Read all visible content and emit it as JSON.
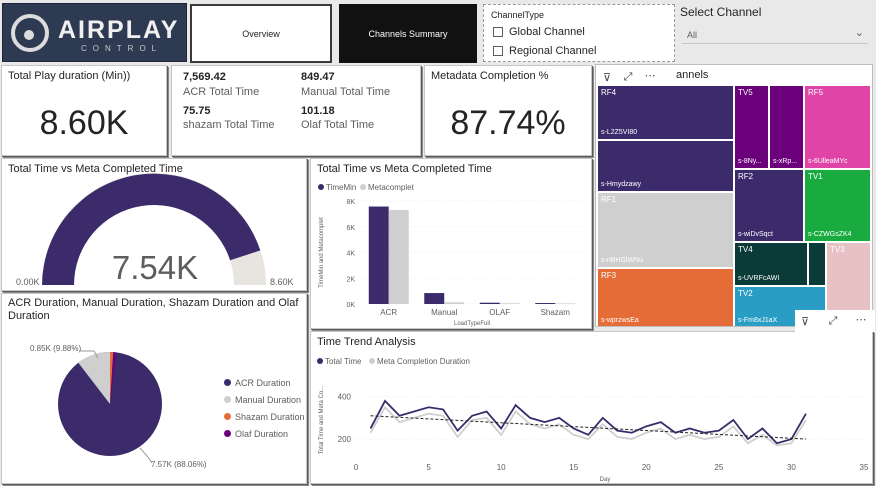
{
  "logo": {
    "main": "AIRPLAY",
    "sub": "CONTROL"
  },
  "nav": {
    "overview": "Overview",
    "channels_summary": "Channels Summary"
  },
  "channel_type": {
    "title": "ChannelType",
    "options": [
      "Global Channel",
      "Regional Channel"
    ]
  },
  "select_channel": {
    "title": "Select Channel",
    "value": "All"
  },
  "total_play": {
    "title": "Total Play duration (Min))",
    "value": "8.60K"
  },
  "multi_card": {
    "acr_value": "7,569.42",
    "acr_label": "ACR Total Time",
    "manual_value": "849.47",
    "manual_label": "Manual Total Time",
    "shazam_value": "75.75",
    "shazam_label": "shazam Total Time",
    "olaf_value": "101.18",
    "olaf_label": "Olaf Total Time"
  },
  "metadata": {
    "title": "Metadata Completion %",
    "value": "87.74%"
  },
  "treemap": {
    "title_suffix": "annels",
    "cells": [
      {
        "head": "RF4",
        "sub": "s-L2Z5VI80"
      },
      {
        "head": "",
        "sub": "s-Hmydzawy"
      },
      {
        "head": "RF1",
        "sub": "s-nBHGlWNu"
      },
      {
        "head": "RF3",
        "sub": "s-wprzwsEa"
      },
      {
        "head": "TV5",
        "sub": "s-8Ny..."
      },
      {
        "head": "",
        "sub": "s-xRp..."
      },
      {
        "head": "RF5",
        "sub": "s-6UlleaMYc"
      },
      {
        "head": "RF2",
        "sub": "s-wiDvSqct"
      },
      {
        "head": "TV1",
        "sub": "s-CZWGsZK4"
      },
      {
        "head": "TV4",
        "sub": "s-UVRFcAWI"
      },
      {
        "head": "",
        "sub": ""
      },
      {
        "head": "TV3",
        "sub": ""
      },
      {
        "head": "TV2",
        "sub": "s-Fm8xJ1aX"
      }
    ]
  },
  "gauge": {
    "title": "Total Time vs Meta Completed Time",
    "value": "7.54K",
    "min": "0.00K",
    "max": "8.60K"
  },
  "pie": {
    "title": "ACR Duration, Manual Duration, Shazam Duration and Olaf Duration",
    "label_small": "0.85K (9.88%)",
    "label_big": "7.57K (88.06%)",
    "legend": [
      "ACR Duration",
      "Manual Duration",
      "Shazam Duration",
      "Olaf Duration"
    ]
  },
  "colors": {
    "purple": "#3b2b6b",
    "grey": "#cfcfcf",
    "orange": "#e66c37",
    "violet": "#6b007b",
    "magenta": "#e044a7",
    "green": "#1aab40",
    "teal": "#2a9dc4",
    "darkgreen": "#0b3b38",
    "pink": "#e8c1c5"
  },
  "chart_data": [
    {
      "type": "bar",
      "title": "Total Time vs Meta Completed Time",
      "categories": [
        "ACR",
        "Manual",
        "OLAF",
        "Shazam"
      ],
      "series": [
        {
          "name": "TimeMin",
          "values": [
            7570,
            850,
            101,
            76
          ]
        },
        {
          "name": "Metacomplet",
          "values": [
            7300,
            130,
            60,
            50
          ]
        }
      ],
      "xlabel": "LoadTypeFull",
      "ylabel": "TimeMin and Metacomplet",
      "yticks": [
        "0K",
        "2K",
        "4K",
        "6K",
        "8K"
      ],
      "ylim": [
        0,
        8000
      ]
    },
    {
      "type": "line",
      "title": "Time Trend Analysis",
      "x": [
        1,
        2,
        3,
        4,
        5,
        6,
        7,
        8,
        9,
        10,
        11,
        12,
        13,
        14,
        15,
        16,
        17,
        18,
        19,
        20,
        21,
        22,
        23,
        24,
        25,
        26,
        27,
        28,
        29,
        30,
        31
      ],
      "series": [
        {
          "name": "Total Time",
          "values": [
            250,
            380,
            310,
            330,
            350,
            340,
            240,
            310,
            330,
            250,
            360,
            300,
            280,
            300,
            250,
            220,
            300,
            240,
            230,
            260,
            280,
            230,
            250,
            230,
            240,
            290,
            200,
            250,
            180,
            200,
            320
          ]
        },
        {
          "name": "Meta Completion Duration",
          "values": [
            230,
            350,
            280,
            300,
            320,
            310,
            210,
            290,
            300,
            220,
            330,
            270,
            250,
            270,
            220,
            200,
            270,
            210,
            200,
            230,
            250,
            200,
            220,
            200,
            210,
            260,
            180,
            220,
            170,
            180,
            290
          ]
        }
      ],
      "trend": [
        310,
        200
      ],
      "xlabel": "Day",
      "ylabel": "Total Time and Meta Co...",
      "xticks": [
        "0",
        "5",
        "10",
        "15",
        "20",
        "25",
        "30",
        "35"
      ],
      "yticks": [
        "200",
        "400"
      ],
      "xlim": [
        0,
        35
      ],
      "ylim": [
        120,
        460
      ]
    }
  ]
}
